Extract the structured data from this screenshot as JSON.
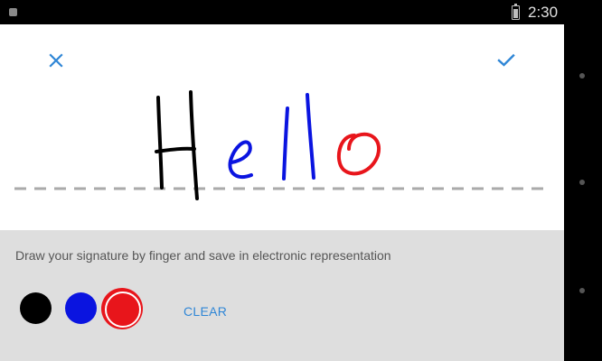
{
  "status_bar": {
    "time": "2:30"
  },
  "signature_screen": {
    "hint": "Draw your signature by finger and save in electronic representation",
    "clear_label": "CLEAR",
    "colors": [
      "#000000",
      "#0a14e0",
      "#e8151b"
    ],
    "selected_color": "#e8151b",
    "icons": {
      "close": "close-icon",
      "confirm": "check-icon"
    }
  }
}
